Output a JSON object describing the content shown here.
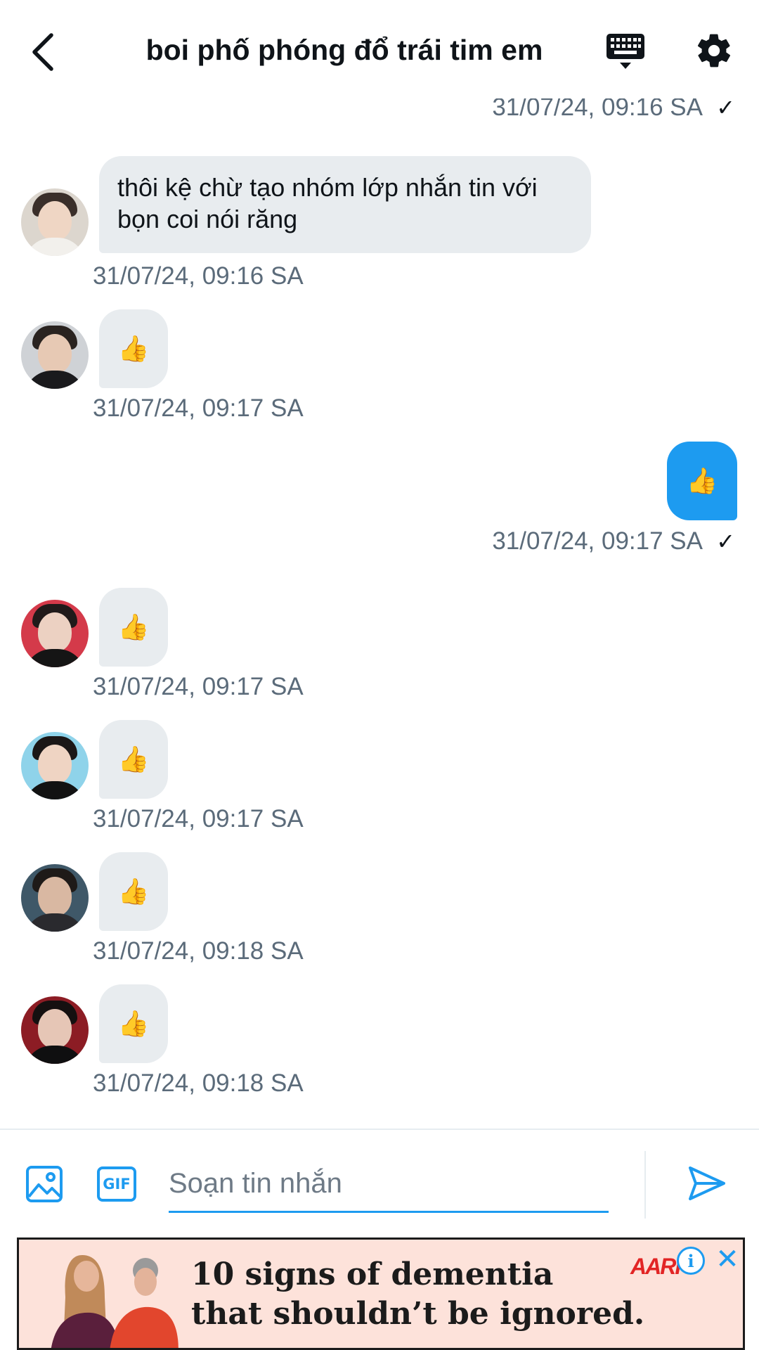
{
  "header": {
    "title": "boi phố phóng đổ trái tim em"
  },
  "messages": [
    {
      "direction": "out",
      "timestamp": "31/07/24, 09:16 SA",
      "status_icon": "check-icon"
    },
    {
      "direction": "in",
      "text": "thôi kệ chừ tạo nhóm lớp nhắn tin với bọn coi nói răng",
      "timestamp": "31/07/24, 09:16 SA",
      "avatar": "avatar-1"
    },
    {
      "direction": "in",
      "emoji": "👍",
      "timestamp": "31/07/24, 09:17 SA",
      "avatar": "avatar-2"
    },
    {
      "direction": "out",
      "emoji": "👍",
      "timestamp": "31/07/24, 09:17 SA",
      "status_icon": "check-icon"
    },
    {
      "direction": "in",
      "emoji": "👍",
      "timestamp": "31/07/24, 09:17 SA",
      "avatar": "avatar-3"
    },
    {
      "direction": "in",
      "emoji": "👍",
      "timestamp": "31/07/24, 09:17 SA",
      "avatar": "avatar-4"
    },
    {
      "direction": "in",
      "emoji": "👍",
      "timestamp": "31/07/24, 09:18 SA",
      "avatar": "avatar-5"
    },
    {
      "direction": "in",
      "emoji": "👍",
      "timestamp": "31/07/24, 09:18 SA",
      "avatar": "avatar-6"
    }
  ],
  "composer": {
    "placeholder": "Soạn tin nhắn",
    "value": "",
    "gif_label": "GIF"
  },
  "ad": {
    "line1": "10 signs of dementia",
    "line2": "that shouldn’t be ignored.",
    "brand_logo": "AARP",
    "info_label": "i",
    "close_label": "✕"
  },
  "icons": {
    "back": "chevron-left-icon",
    "keyboard": "keyboard-icon",
    "settings": "gear-icon",
    "image": "image-icon",
    "gif": "gif-icon",
    "send": "send-icon",
    "check": "check-icon"
  },
  "colors": {
    "accent": "#1d9bf0",
    "incoming_bubble": "#e8ecef",
    "timestamp": "#5b6b7a",
    "ad_background": "#fde2da"
  }
}
